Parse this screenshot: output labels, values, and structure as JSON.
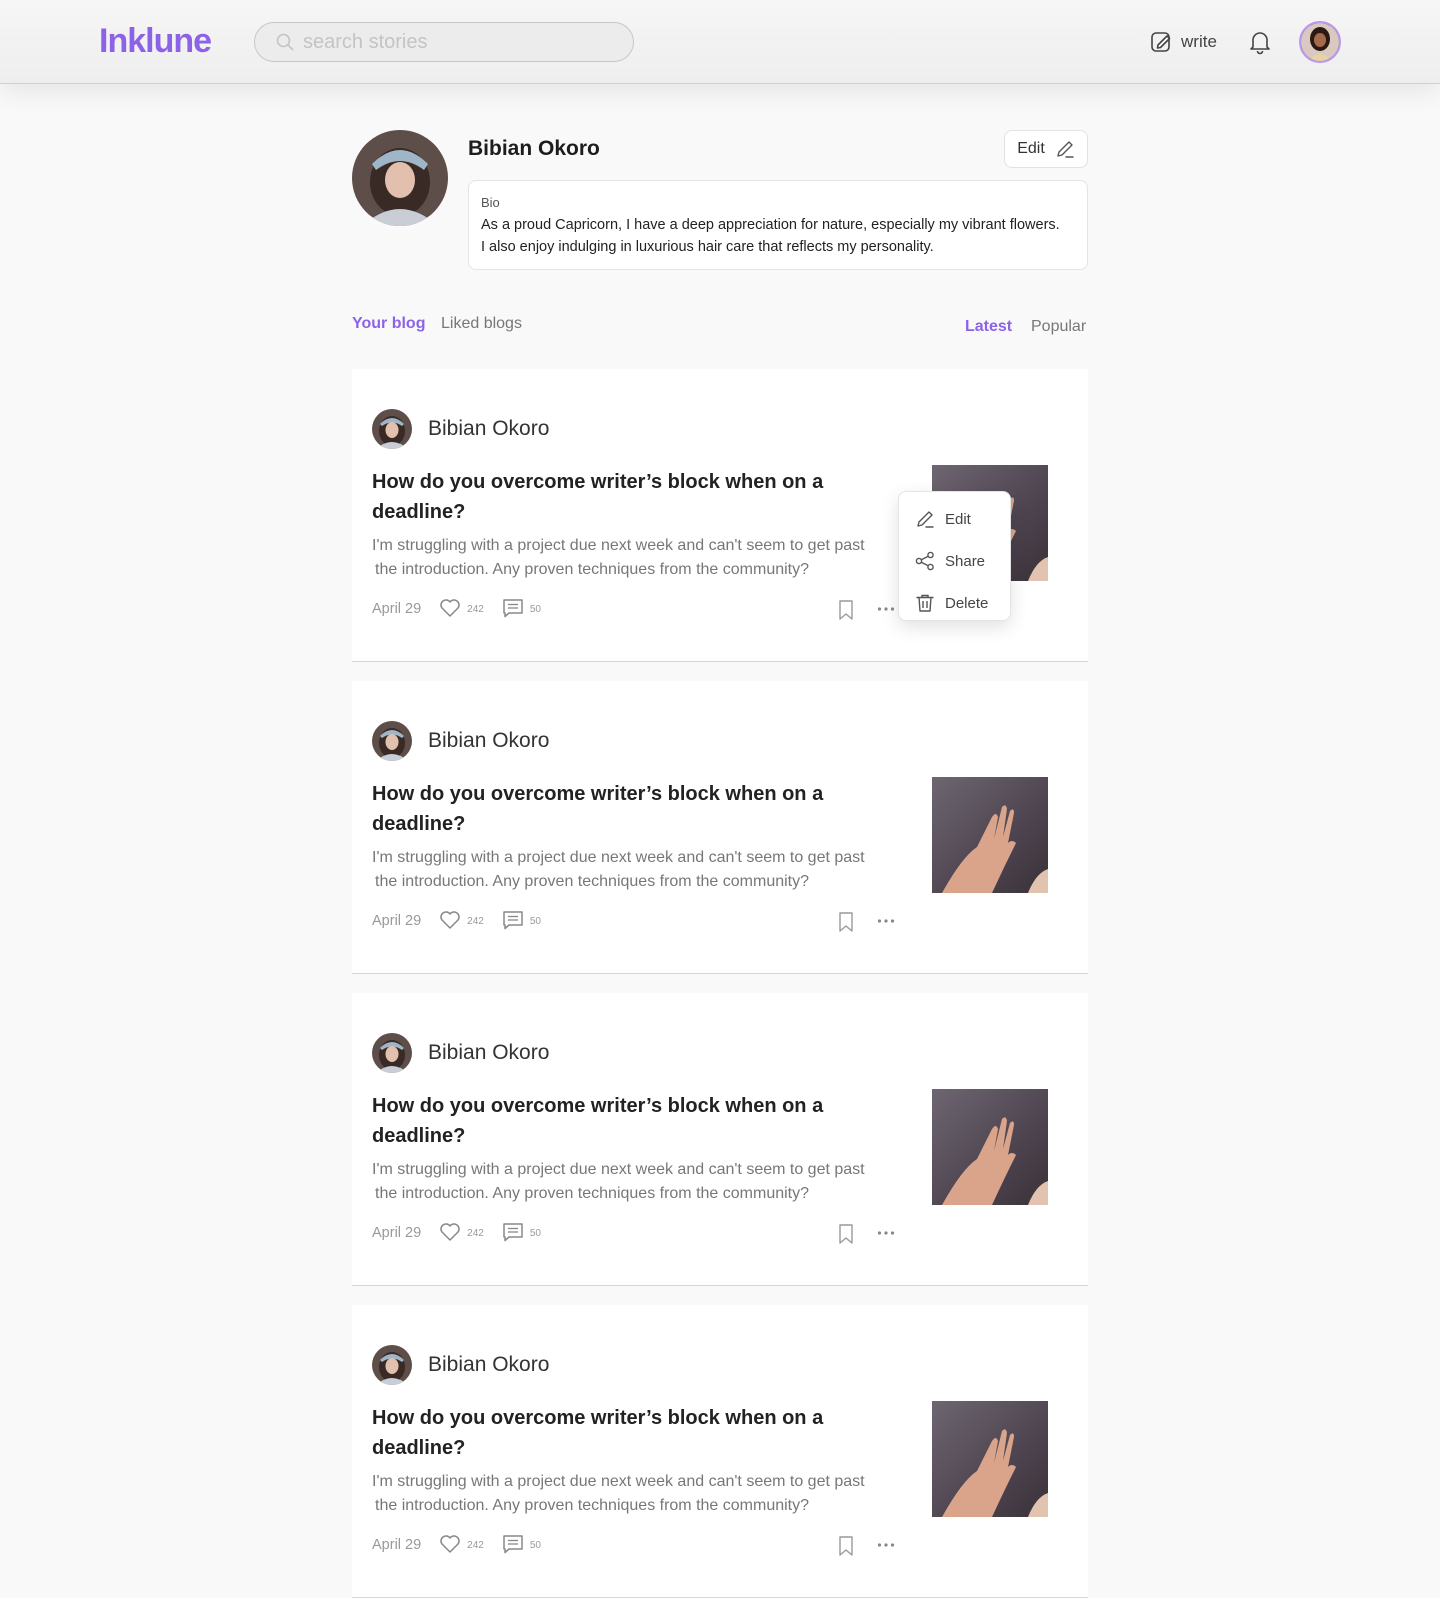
{
  "header": {
    "logo": "Inklune",
    "search_placeholder": "search stories",
    "write_label": "write"
  },
  "profile": {
    "name": "Bibian Okoro",
    "edit_label": "Edit",
    "bio_label": "Bio",
    "bio_line1": "As a proud Capricorn, I have a deep appreciation for nature, especially my vibrant flowers.",
    "bio_line2": "I also enjoy indulging in luxurious hair care that reflects my personality."
  },
  "tabs": [
    {
      "label": "Your blog",
      "active": true
    },
    {
      "label": "Liked blogs",
      "active": false
    }
  ],
  "sort": [
    {
      "label": "Latest",
      "active": true
    },
    {
      "label": "Popular",
      "active": false
    }
  ],
  "posts": [
    {
      "author": "Bibian Okoro",
      "title_line1": "How do you overcome writer’s block when on a",
      "title_line2": "deadline?",
      "excerpt_line1": "I'm struggling with a project due next week and can't seem to get past",
      "excerpt_line2": "the introduction. Any proven techniques from the community?",
      "date": "April 29",
      "likes": "242",
      "comments": "50"
    },
    {
      "author": "Bibian Okoro",
      "title_line1": "How do you overcome writer’s block when on a",
      "title_line2": "deadline?",
      "excerpt_line1": "I'm struggling with a project due next week and can't seem to get past",
      "excerpt_line2": "the introduction. Any proven techniques from the community?",
      "date": "April 29",
      "likes": "242",
      "comments": "50"
    },
    {
      "author": "Bibian Okoro",
      "title_line1": "How do you overcome writer’s block when on a",
      "title_line2": "deadline?",
      "excerpt_line1": "I'm struggling with a project due next week and can't seem to get past",
      "excerpt_line2": "the introduction. Any proven techniques from the community?",
      "date": "April 29",
      "likes": "242",
      "comments": "50"
    },
    {
      "author": "Bibian Okoro",
      "title_line1": "How do you overcome writer’s block when on a",
      "title_line2": "deadline?",
      "excerpt_line1": "I'm struggling with a project due next week and can't seem to get past",
      "excerpt_line2": "the introduction. Any proven techniques from the community?",
      "date": "April 29",
      "likes": "242",
      "comments": "50"
    }
  ],
  "context_menu": {
    "edit": "Edit",
    "share": "Share",
    "delete": "Delete"
  },
  "colors": {
    "accent": "#8c63e8",
    "muted_text": "#777777"
  }
}
